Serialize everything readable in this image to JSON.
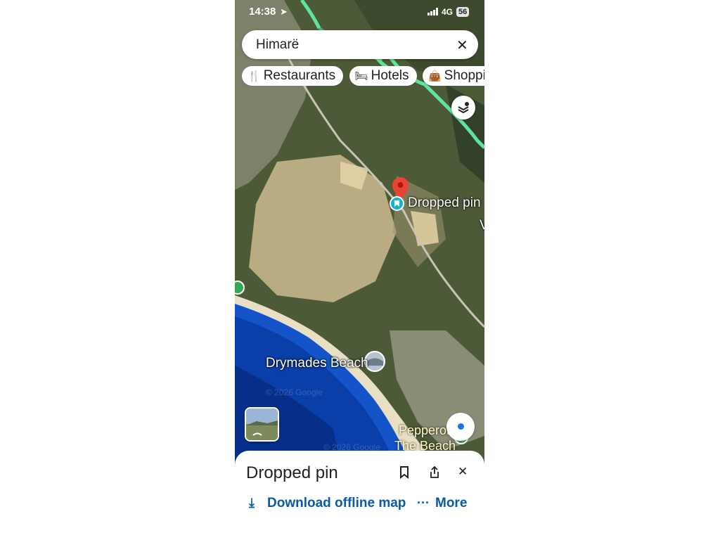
{
  "status_bar": {
    "time": "14:38",
    "location_icon": "location-arrow-icon",
    "network": "4G",
    "battery": "56"
  },
  "search": {
    "query": "Himarë",
    "clear_icon": "close-icon"
  },
  "chips": [
    {
      "label": "Restaurants",
      "icon": "fork-knife-icon"
    },
    {
      "label": "Hotels",
      "icon": "bed-icon"
    },
    {
      "label": "Shopping",
      "icon": "shopping-bag-icon"
    }
  ],
  "map": {
    "dropped_pin_label": "Dropped pin",
    "beach_label": "Drymades Beach",
    "place_label_line1": "Pepperon",
    "place_label_line2": "The Beach",
    "watermark": "© 2026 Google",
    "edge_glyph": "V"
  },
  "sheet": {
    "title": "Dropped pin",
    "download_label": "Download offline map",
    "more_label": "More"
  },
  "colors": {
    "accent": "#0b5aa6",
    "pin": "#ea4335",
    "route": "#5fe3a1",
    "sea": "#0a3ea8"
  }
}
